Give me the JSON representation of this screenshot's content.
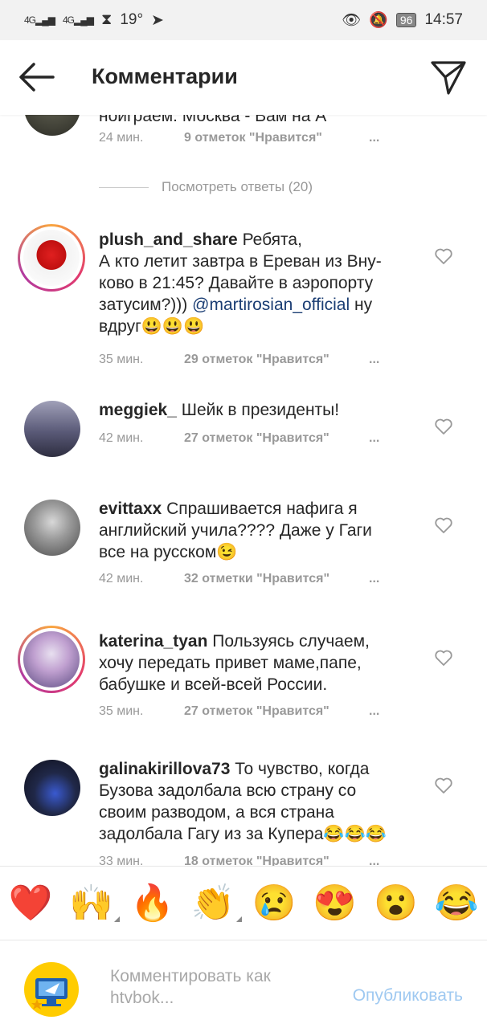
{
  "status": {
    "net1": "4G",
    "net2": "4G",
    "temp": "19°",
    "battery": "96",
    "time": "14:57"
  },
  "header": {
    "title": "Комментарии"
  },
  "top_comment": {
    "partial_text": "ноиграем: Москва - Вам на А",
    "time": "24 мин.",
    "likes": "9 отметок \"Нравится\"",
    "more": "..."
  },
  "replies_link": "Посмотреть ответы (20)",
  "comments": [
    {
      "user": "plush_and_share",
      "text_a": "Ребята,\nА кто летит завтра в Ереван из Вну-\nково в 21:45? Давайте в аэропорту\nзатусим?))) ",
      "mention": "@martirosian_official",
      "text_b": "  ну\nвдруг😃😃😃",
      "time": "35 мин.",
      "likes": "29 отметок \"Нравится\"",
      "more": "..."
    },
    {
      "user": "meggiek_",
      "text_a": "Шейк в президенты!",
      "mention": "",
      "text_b": "",
      "time": "42 мин.",
      "likes": "27 отметок \"Нравится\"",
      "more": "..."
    },
    {
      "user": "evittaxx",
      "text_a": "Спрашивается нафига я\nанглийский учила???? Даже у Гаги\nвсе на русском😉",
      "mention": "",
      "text_b": "",
      "time": "42 мин.",
      "likes": "32 отметки \"Нравится\"",
      "more": "..."
    },
    {
      "user": "katerina_tyan",
      "text_a": "Пользуясь случаем,\nхочу передать привет маме,папе,\nбабушке и всей-всей России.",
      "mention": "",
      "text_b": "",
      "time": "35 мин.",
      "likes": "27 отметок \"Нравится\"",
      "more": "..."
    },
    {
      "user": "galinakirillova73",
      "text_a": "То чувство, когда\nБузова задолбала всю страну со\nсвоим разводом, а вся страна\nзадолбала Гагу из за Купера😂😂😂",
      "mention": "",
      "text_b": "",
      "time": "33 мин.",
      "likes": "18 отметок \"Нравится\"",
      "more": "..."
    }
  ],
  "reactions": [
    "❤️",
    "🙌",
    "🔥",
    "👏",
    "😢",
    "😍",
    "😮",
    "😂"
  ],
  "composer": {
    "placeholder": "Комментировать как\nhtvbok...",
    "publish": "Опубликовать"
  },
  "colors": {
    "accent": "#3897f0",
    "publish_disabled": "#9fc9f1",
    "meta": "#999999"
  }
}
